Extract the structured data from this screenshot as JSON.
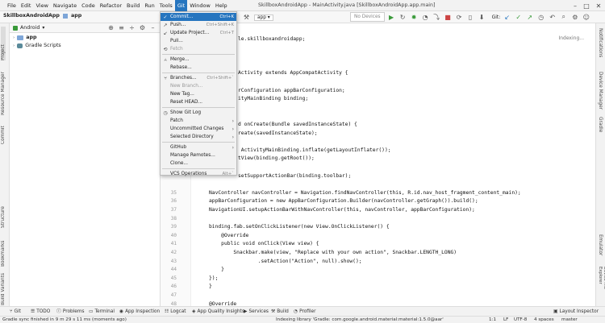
{
  "window": {
    "title": "SkillboxAndroidApp - MainActivity.java [SkillboxAndroidApp.app.main]"
  },
  "menubar": {
    "items": [
      "File",
      "Edit",
      "View",
      "Navigate",
      "Code",
      "Refactor",
      "Build",
      "Run",
      "Tools",
      "Git",
      "Window",
      "Help"
    ],
    "active": "Git"
  },
  "toolbar": {
    "project": "SkillboxAndroidApp",
    "module": "app",
    "device": "No Devices",
    "git_label": "Git:"
  },
  "project_panel": {
    "view": "Android",
    "tree": [
      {
        "label": "app",
        "type": "folder"
      },
      {
        "label": "Gradle Scripts",
        "type": "gradle"
      }
    ]
  },
  "left_tabs": [
    "Project",
    "Resource Manager",
    "Commit",
    "Structure",
    "Bookmarks",
    "Build Variants"
  ],
  "right_tabs": [
    "Notifications",
    "Device Manager",
    "Gradle",
    "Emulator",
    "Device File Explorer"
  ],
  "git_menu": {
    "items": [
      {
        "label": "Commit...",
        "shortcut": "Ctrl+K",
        "icon": "check-icon",
        "state": "highlighted"
      },
      {
        "label": "Push...",
        "shortcut": "Ctrl+Shift+K",
        "icon": "push-icon",
        "state": "normal"
      },
      {
        "label": "Update Project...",
        "shortcut": "Ctrl+T",
        "icon": "update-icon",
        "state": "normal"
      },
      {
        "label": "Pull...",
        "shortcut": "",
        "icon": "",
        "state": "normal"
      },
      {
        "label": "Fetch",
        "shortcut": "",
        "icon": "fetch-icon",
        "state": "disabled"
      },
      {
        "label": "Merge...",
        "shortcut": "",
        "icon": "merge-icon",
        "state": "normal"
      },
      {
        "label": "Rebase...",
        "shortcut": "",
        "icon": "",
        "state": "normal"
      },
      {
        "label": "Branches...",
        "shortcut": "Ctrl+Shift+`",
        "icon": "branch-icon",
        "state": "normal"
      },
      {
        "label": "New Branch...",
        "shortcut": "",
        "icon": "",
        "state": "disabled"
      },
      {
        "label": "New Tag...",
        "shortcut": "",
        "icon": "",
        "state": "normal"
      },
      {
        "label": "Reset HEAD...",
        "shortcut": "",
        "icon": "",
        "state": "normal"
      },
      {
        "label": "Show Git Log",
        "shortcut": "",
        "icon": "log-icon",
        "state": "normal"
      },
      {
        "label": "Patch",
        "shortcut": "",
        "icon": "",
        "state": "submenu"
      },
      {
        "label": "Uncommitted Changes",
        "shortcut": "",
        "icon": "",
        "state": "submenu"
      },
      {
        "label": "Selected Directory",
        "shortcut": "",
        "icon": "",
        "state": "submenu"
      },
      {
        "label": "GitHub",
        "shortcut": "",
        "icon": "",
        "state": "submenu"
      },
      {
        "label": "Manage Remotes...",
        "shortcut": "",
        "icon": "",
        "state": "normal"
      },
      {
        "label": "Clone...",
        "shortcut": "",
        "icon": "",
        "state": "normal"
      },
      {
        "label": "VCS Operations",
        "shortcut": "Alt+`",
        "icon": "",
        "state": "normal"
      }
    ]
  },
  "editor": {
    "indexing": "Indexing...",
    "lines": [
      {
        "n": "",
        "t": "le.skillboxandroidapp;"
      },
      {
        "n": "",
        "t": ""
      },
      {
        "n": "",
        "t": ""
      },
      {
        "n": "",
        "t": ""
      },
      {
        "n": "",
        "t": "Activity extends AppCompatActivity {"
      },
      {
        "n": "",
        "t": ""
      },
      {
        "n": "",
        "t": "rConfiguration appBarConfiguration;"
      },
      {
        "n": "",
        "t": "ityMainBinding binding;"
      },
      {
        "n": "",
        "t": ""
      },
      {
        "n": "",
        "t": ""
      },
      {
        "n": "",
        "t": "d onCreate(Bundle savedInstanceState) {"
      },
      {
        "n": "",
        "t": "reate(savedInstanceState);"
      },
      {
        "n": "",
        "t": ""
      },
      {
        "n": "",
        "t": " ActivityMainBinding.inflate(getLayoutInflater());"
      },
      {
        "n": "",
        "t": "tView(binding.getRoot());"
      },
      {
        "n": "",
        "t": ""
      },
      {
        "n": "",
        "t": "setSupportActionBar(binding.toolbar);"
      },
      {
        "n": "",
        "t": ""
      },
      {
        "n": "35",
        "t": "NavController navController = Navigation.findNavController(this, R.id.nav_host_fragment_content_main);"
      },
      {
        "n": "36",
        "t": "appBarConfiguration = new AppBarConfiguration.Builder(navController.getGraph()).build();"
      },
      {
        "n": "37",
        "t": "NavigationUI.setupActionBarWithNavController(this, navController, appBarConfiguration);"
      },
      {
        "n": "38",
        "t": ""
      },
      {
        "n": "39",
        "t": "binding.fab.setOnClickListener(new View.OnClickListener() {"
      },
      {
        "n": "40",
        "t": "    @Override"
      },
      {
        "n": "41",
        "t": "    public void onClick(View view) {"
      },
      {
        "n": "42",
        "t": "        Snackbar.make(view, \"Replace with your own action\", Snackbar.LENGTH_LONG)"
      },
      {
        "n": "43",
        "t": "                .setAction(\"Action\", null).show();"
      },
      {
        "n": "44",
        "t": "    }"
      },
      {
        "n": "45",
        "t": "});"
      },
      {
        "n": "46",
        "t": "}"
      },
      {
        "n": "47",
        "t": ""
      },
      {
        "n": "48",
        "t": "@Override"
      }
    ]
  },
  "bottom_tools": [
    "Git",
    "TODO",
    "Problems",
    "Terminal",
    "App Inspection",
    "Logcat",
    "App Quality Insights",
    "Services",
    "Build",
    "Profiler",
    "Layout Inspector"
  ],
  "status": {
    "message": "Gradle sync finished in 9 m 29 s 11 ms (moments ago)",
    "indexing": "Indexing library 'Gradle: com.google.android.material:material:1.5.0@aar'",
    "position": "1:1",
    "line_sep": "LF",
    "encoding": "UTF-8",
    "indent": "4 spaces",
    "branch": "master"
  }
}
